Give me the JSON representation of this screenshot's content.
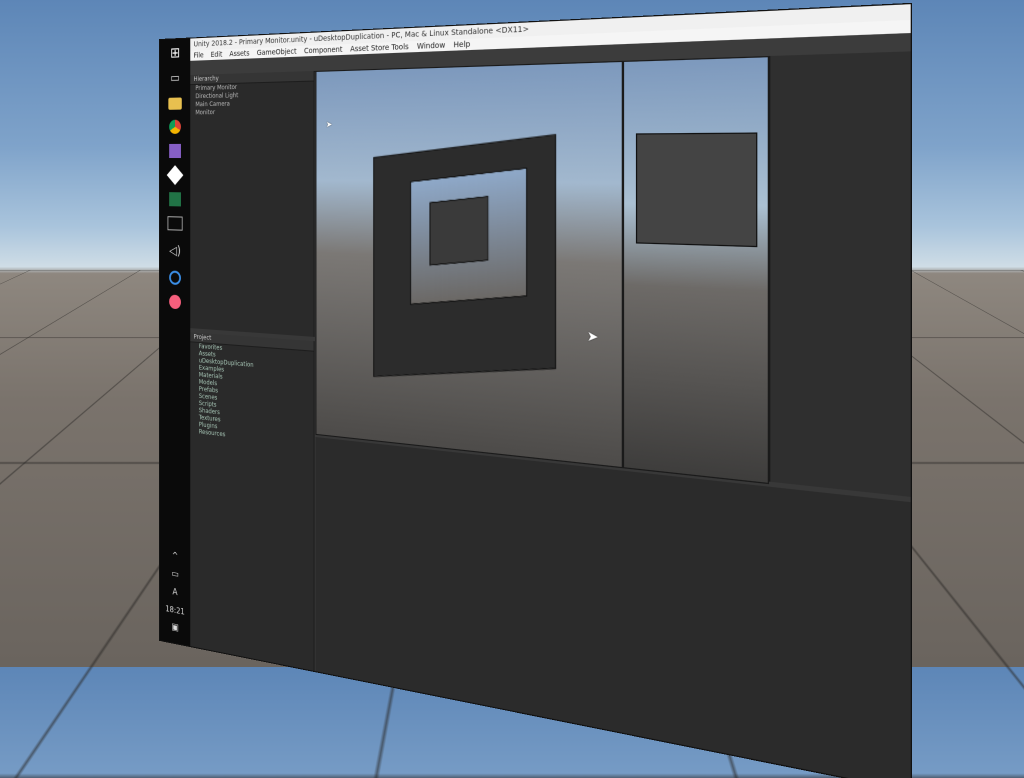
{
  "window": {
    "title": "Unity 2018.2 - Primary Monitor.unity - uDesktopDuplication - PC, Mac & Linux Standalone <DX11>",
    "menu": [
      "File",
      "Edit",
      "Assets",
      "GameObject",
      "Component",
      "Asset Store Tools",
      "Window",
      "Help"
    ]
  },
  "taskbar": {
    "icons": [
      "windows-icon",
      "task-view-icon",
      "file-explorer-icon",
      "chrome-icon",
      "visual-studio-icon",
      "unity-icon",
      "excel-icon",
      "terminal-icon",
      "volume-icon",
      "cortana-icon",
      "itunes-icon"
    ],
    "clock": "18:21"
  },
  "hierarchy": {
    "header": "Hierarchy",
    "rows": [
      "Primary Monitor",
      "Directional Light",
      "Main Camera",
      "Monitor"
    ]
  },
  "project": {
    "header": "Project",
    "rows": [
      "Favorites",
      "Assets",
      "uDesktopDuplication",
      "Examples",
      "Materials",
      "Models",
      "Prefabs",
      "Scenes",
      "Scripts",
      "Shaders",
      "Textures",
      "Plugins",
      "Resources"
    ]
  },
  "colors": {
    "sky_top": "#5d86b7",
    "ground": "#7a736c",
    "editor_bg": "#383838"
  }
}
